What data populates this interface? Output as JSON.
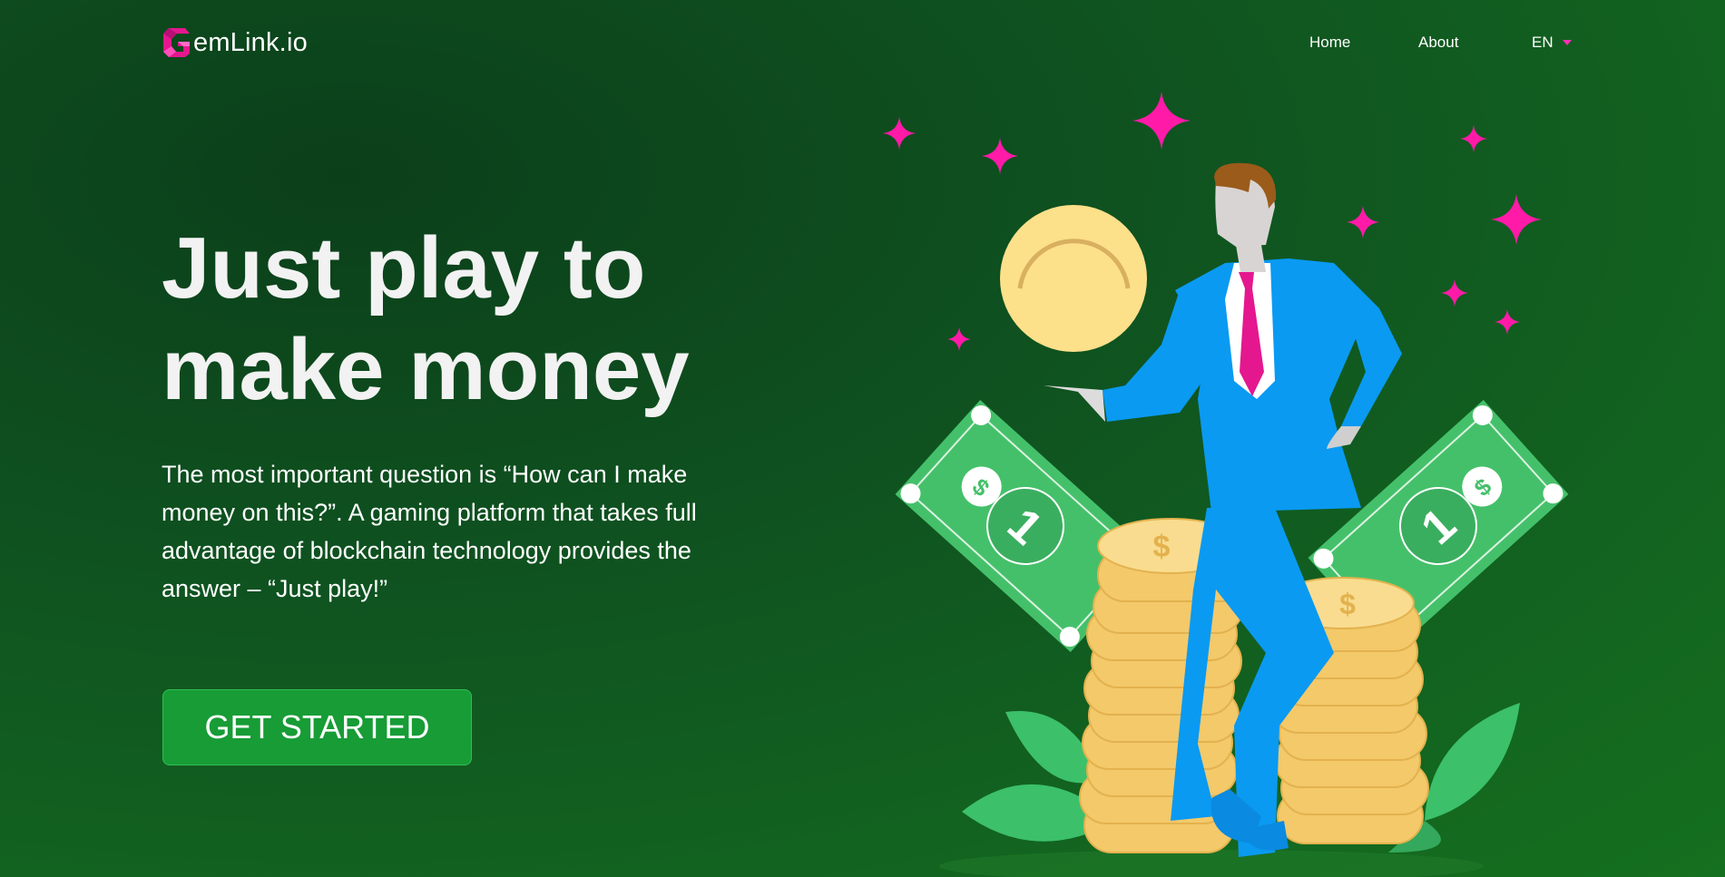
{
  "brand": {
    "name": "emLink.io",
    "accent": "#e4178f"
  },
  "nav": {
    "home": "Home",
    "about": "About",
    "language": "EN"
  },
  "hero": {
    "title_line1": "Just play to",
    "title_line2": "make money",
    "description": "The most important question is “How can I make money on this?”. A gaming platform that takes full advantage of blockchain technology provides the answer – “Just play!”",
    "cta": "GET STARTED"
  },
  "colors": {
    "background": "#0f5220",
    "button": "#179c36",
    "sparkle": "#ff1aa8",
    "suit": "#0a9af2",
    "coin": "#f7d98a",
    "cash": "#45c06a"
  },
  "icons": {
    "logo": "gem-g-logo-icon",
    "language_caret": "caret-down-icon"
  }
}
